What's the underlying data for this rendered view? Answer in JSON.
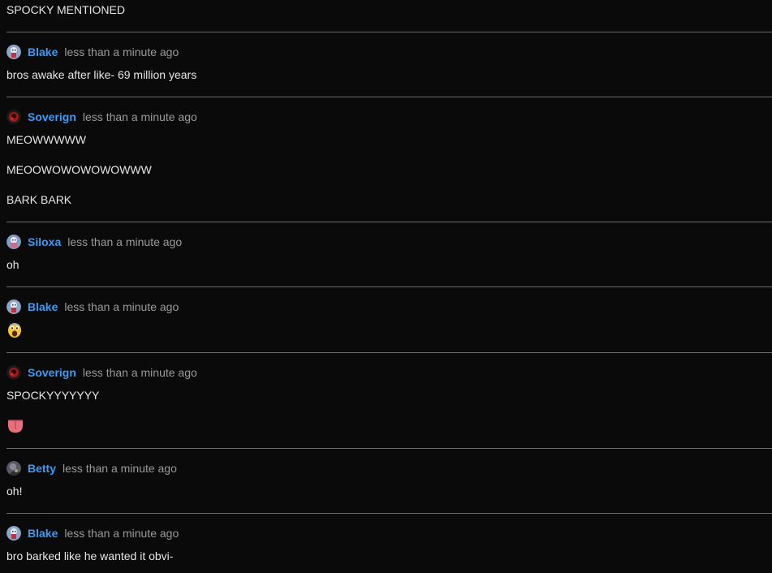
{
  "top_text": "SPOCKY MENTIONED",
  "colors": {
    "background": "#0a0a0a",
    "username": "#3d9bf2",
    "timestamp": "#9a9a9a",
    "text": "#e6e6e6",
    "divider": "#6a6a6a"
  },
  "messages": [
    {
      "author": "Blake",
      "avatar": "blake-avatar",
      "time": "less than a minute ago",
      "lines": [
        "bros awake after like- 69 million years"
      ]
    },
    {
      "author": "Soverign",
      "avatar": "soverign-avatar",
      "time": "less than a minute ago",
      "lines": [
        "MEOWWWWW",
        "MEOOWOWOWOWOWWW",
        "BARK BARK"
      ]
    },
    {
      "author": "Siloxa",
      "avatar": "siloxa-avatar",
      "time": "less than a minute ago",
      "lines": [
        "oh"
      ]
    },
    {
      "author": "Blake",
      "avatar": "blake-avatar",
      "time": "less than a minute ago",
      "emoji": "fearful-face-emoji"
    },
    {
      "author": "Soverign",
      "avatar": "soverign-avatar",
      "time": "less than a minute ago",
      "lines": [
        "SPOCKYYYYYYY"
      ],
      "emoji": "tongue-emoji"
    },
    {
      "author": "Betty",
      "avatar": "betty-avatar",
      "time": "less than a minute ago",
      "lines": [
        "oh!"
      ]
    },
    {
      "author": "Blake",
      "avatar": "blake-avatar",
      "time": "less than a minute ago",
      "lines": [
        "bro barked like he wanted it obvi-"
      ]
    }
  ]
}
